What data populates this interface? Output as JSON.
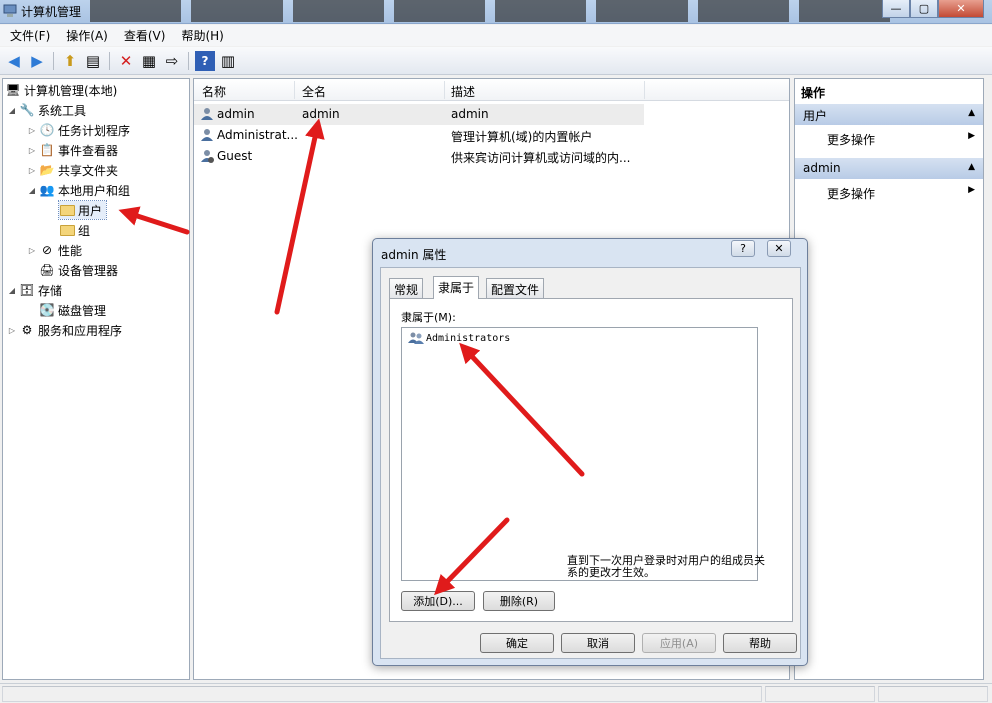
{
  "window": {
    "title": "计算机管理",
    "buttons": {
      "minimize": "—",
      "maximize": "▢",
      "close": "✕"
    }
  },
  "menu": [
    "文件(F)",
    "操作(A)",
    "查看(V)",
    "帮助(H)"
  ],
  "tree": [
    {
      "label": "计算机管理(本地)",
      "icon": "computer-icon"
    },
    {
      "label": "系统工具",
      "icon": "tools-icon"
    },
    {
      "label": "任务计划程序",
      "icon": "clock-icon"
    },
    {
      "label": "事件查看器",
      "icon": "event-viewer-icon"
    },
    {
      "label": "共享文件夹",
      "icon": "shared-folder-icon"
    },
    {
      "label": "本地用户和组",
      "icon": "users-groups-icon"
    },
    {
      "label": "用户",
      "icon": "folder-icon"
    },
    {
      "label": "组",
      "icon": "folder-icon"
    },
    {
      "label": "性能",
      "icon": "performance-icon"
    },
    {
      "label": "设备管理器",
      "icon": "device-manager-icon"
    },
    {
      "label": "存储",
      "icon": "storage-icon"
    },
    {
      "label": "磁盘管理",
      "icon": "disk-icon"
    },
    {
      "label": "服务和应用程序",
      "icon": "services-icon"
    }
  ],
  "list": {
    "columns": [
      "名称",
      "全名",
      "描述"
    ],
    "rows": [
      {
        "name": "admin",
        "fullname": "admin",
        "desc": "admin"
      },
      {
        "name": "Administrat...",
        "fullname": "",
        "desc": "管理计算机(域)的内置帐户"
      },
      {
        "name": "Guest",
        "fullname": "",
        "desc": "供来宾访问计算机或访问域的内..."
      }
    ]
  },
  "actions": {
    "header": "操作",
    "groups": [
      {
        "title": "用户",
        "item": "更多操作"
      },
      {
        "title": "admin",
        "item": "更多操作"
      }
    ]
  },
  "dialog": {
    "title": "admin 属性",
    "help_glyph": "?",
    "close_glyph": "✕",
    "tabs": [
      "常规",
      "隶属于",
      "配置文件"
    ],
    "memberof_label": "隶属于(M):",
    "groups": [
      "Administrators"
    ],
    "add_label": "添加(D)...",
    "remove_label": "删除(R)",
    "note": "直到下一次用户登录时对用户的组成员关系的更改才生效。",
    "ok_label": "确定",
    "cancel_label": "取消",
    "apply_label": "应用(A)",
    "help_label": "帮助"
  },
  "colors": {
    "annotation_arrow": "#e01b1b",
    "selection": "#e5eefa",
    "action_group": "#c8d7ec"
  }
}
